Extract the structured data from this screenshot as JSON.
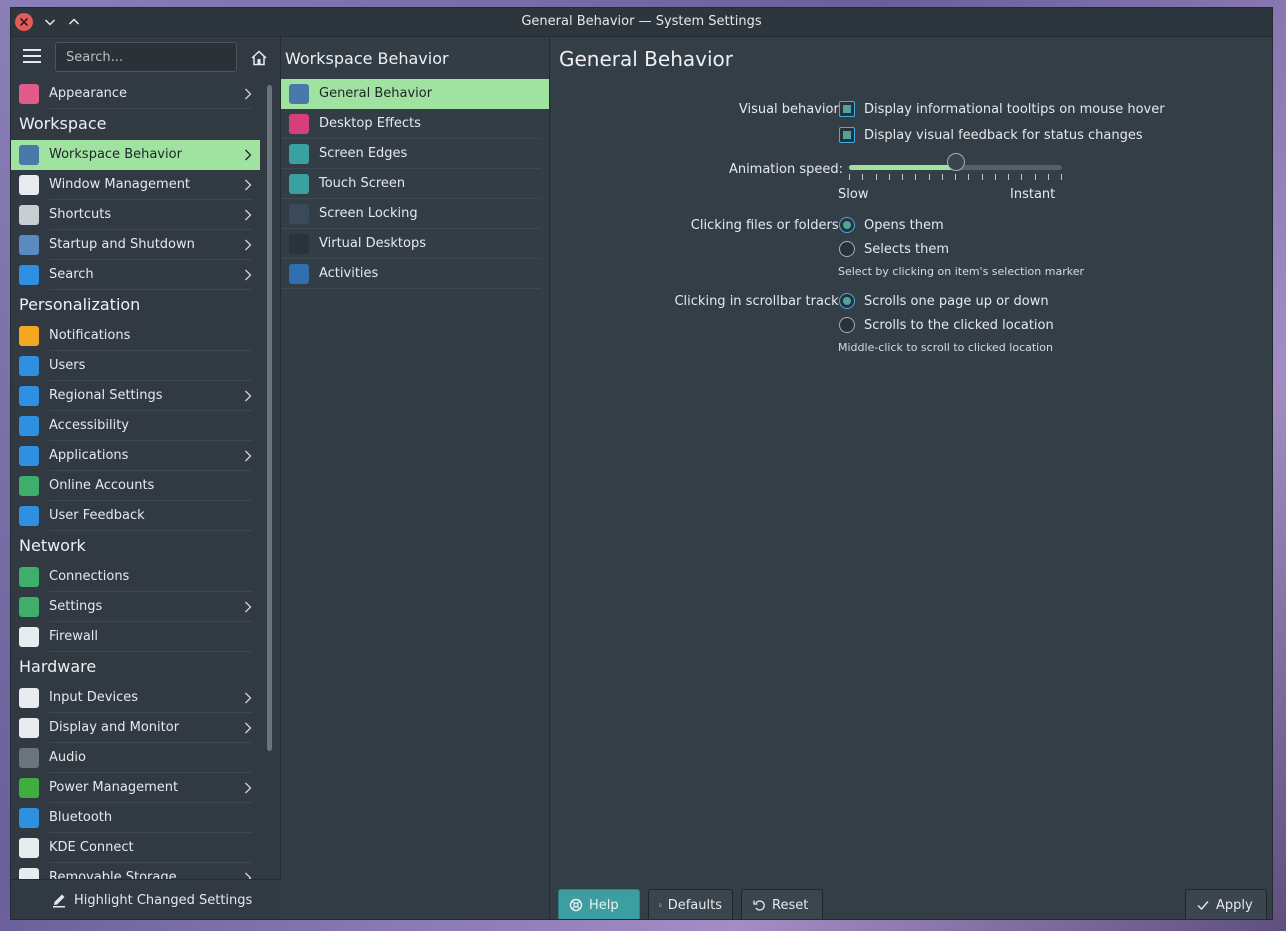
{
  "window": {
    "title": "General Behavior — System Settings"
  },
  "sidebar": {
    "search_placeholder": "Search...",
    "footer_label": "Highlight Changed Settings",
    "items": [
      {
        "type": "item",
        "label": "Appearance",
        "icon": "appearance-icon",
        "chevron": true,
        "color": "#e05a8a"
      },
      {
        "type": "category",
        "label": "Workspace"
      },
      {
        "type": "item",
        "label": "Workspace Behavior",
        "icon": "workspace-behavior-icon",
        "chevron": true,
        "selected": true,
        "color": "#4a78a8"
      },
      {
        "type": "item",
        "label": "Window Management",
        "icon": "window-management-icon",
        "chevron": true,
        "color": "#e8ecef"
      },
      {
        "type": "item",
        "label": "Shortcuts",
        "icon": "keyboard-icon",
        "chevron": true,
        "color": "#c9ced3"
      },
      {
        "type": "item",
        "label": "Startup and Shutdown",
        "icon": "startup-icon",
        "chevron": true,
        "color": "#5a8ac0"
      },
      {
        "type": "item",
        "label": "Search",
        "icon": "search-icon",
        "chevron": true,
        "color": "#2f8fe0"
      },
      {
        "type": "category",
        "label": "Personalization"
      },
      {
        "type": "item",
        "label": "Notifications",
        "icon": "bell-icon",
        "chevron": false,
        "color": "#f5a623"
      },
      {
        "type": "item",
        "label": "Users",
        "icon": "users-icon",
        "chevron": false,
        "color": "#2f8fe0"
      },
      {
        "type": "item",
        "label": "Regional Settings",
        "icon": "regional-icon",
        "chevron": true,
        "color": "#2f8fe0"
      },
      {
        "type": "item",
        "label": "Accessibility",
        "icon": "accessibility-icon",
        "chevron": false,
        "color": "#2f8fe0"
      },
      {
        "type": "item",
        "label": "Applications",
        "icon": "applications-icon",
        "chevron": true,
        "color": "#2f8fe0"
      },
      {
        "type": "item",
        "label": "Online Accounts",
        "icon": "globe-icon",
        "chevron": false,
        "color": "#3fae6a"
      },
      {
        "type": "item",
        "label": "User Feedback",
        "icon": "feedback-icon",
        "chevron": false,
        "color": "#2f8fe0"
      },
      {
        "type": "category",
        "label": "Network"
      },
      {
        "type": "item",
        "label": "Connections",
        "icon": "connections-icon",
        "chevron": false,
        "color": "#3fae6a"
      },
      {
        "type": "item",
        "label": "Settings",
        "icon": "network-settings-icon",
        "chevron": true,
        "color": "#3fae6a"
      },
      {
        "type": "item",
        "label": "Firewall",
        "icon": "firewall-icon",
        "chevron": false,
        "color": "#e8ecef"
      },
      {
        "type": "category",
        "label": "Hardware"
      },
      {
        "type": "item",
        "label": "Input Devices",
        "icon": "input-devices-icon",
        "chevron": true,
        "color": "#e8ecef"
      },
      {
        "type": "item",
        "label": "Display and Monitor",
        "icon": "monitor-icon",
        "chevron": true,
        "color": "#e8ecef"
      },
      {
        "type": "item",
        "label": "Audio",
        "icon": "speaker-icon",
        "chevron": false,
        "color": "#6b747c"
      },
      {
        "type": "item",
        "label": "Power Management",
        "icon": "power-icon",
        "chevron": true,
        "color": "#3fae3f"
      },
      {
        "type": "item",
        "label": "Bluetooth",
        "icon": "bluetooth-icon",
        "chevron": false,
        "color": "#2f8fe0"
      },
      {
        "type": "item",
        "label": "KDE Connect",
        "icon": "phone-icon",
        "chevron": false,
        "color": "#e8ecef"
      },
      {
        "type": "item",
        "label": "Removable Storage",
        "icon": "usb-icon",
        "chevron": true,
        "color": "#e8ecef"
      }
    ]
  },
  "middle": {
    "header": "Workspace Behavior",
    "items": [
      {
        "label": "General Behavior",
        "icon": "general-behavior-icon",
        "selected": true,
        "color": "#4a78a8"
      },
      {
        "label": "Desktop Effects",
        "icon": "desktop-effects-icon",
        "color": "#d6407a"
      },
      {
        "label": "Screen Edges",
        "icon": "screen-edges-icon",
        "color": "#3aa0a0"
      },
      {
        "label": "Touch Screen",
        "icon": "touch-screen-icon",
        "color": "#3aa0a0"
      },
      {
        "label": "Screen Locking",
        "icon": "screen-locking-icon",
        "color": "#3a4a58"
      },
      {
        "label": "Virtual Desktops",
        "icon": "virtual-desktops-icon",
        "color": "#2b333a"
      },
      {
        "label": "Activities",
        "icon": "activities-icon",
        "color": "#2f6fb0"
      }
    ]
  },
  "content": {
    "title": "General Behavior",
    "visual_behavior": {
      "label": "Visual behavior:",
      "options": [
        {
          "label": "Display informational tooltips on mouse hover",
          "checked": true
        },
        {
          "label": "Display visual feedback for status changes",
          "checked": true
        }
      ]
    },
    "animation_speed": {
      "label": "Animation speed:",
      "min_label": "Slow",
      "max_label": "Instant",
      "value_fraction": 0.5,
      "tick_count": 17
    },
    "clicking_files": {
      "label": "Clicking files or folders:",
      "options": [
        {
          "label": "Opens them",
          "checked": true
        },
        {
          "label": "Selects them",
          "checked": false
        }
      ],
      "hint": "Select by clicking on item's selection marker"
    },
    "scrollbar_track": {
      "label": "Clicking in scrollbar track:",
      "options": [
        {
          "label": "Scrolls one page up or down",
          "checked": true
        },
        {
          "label": "Scrolls to the clicked location",
          "checked": false
        }
      ],
      "hint": "Middle-click to scroll to clicked location"
    }
  },
  "buttons": {
    "help": "Help",
    "defaults": "Defaults",
    "reset": "Reset",
    "apply": "Apply"
  },
  "colors": {
    "accent_selection": "#a0e29f",
    "accent_check": "#52a3a0",
    "focus": "#3daee9"
  }
}
